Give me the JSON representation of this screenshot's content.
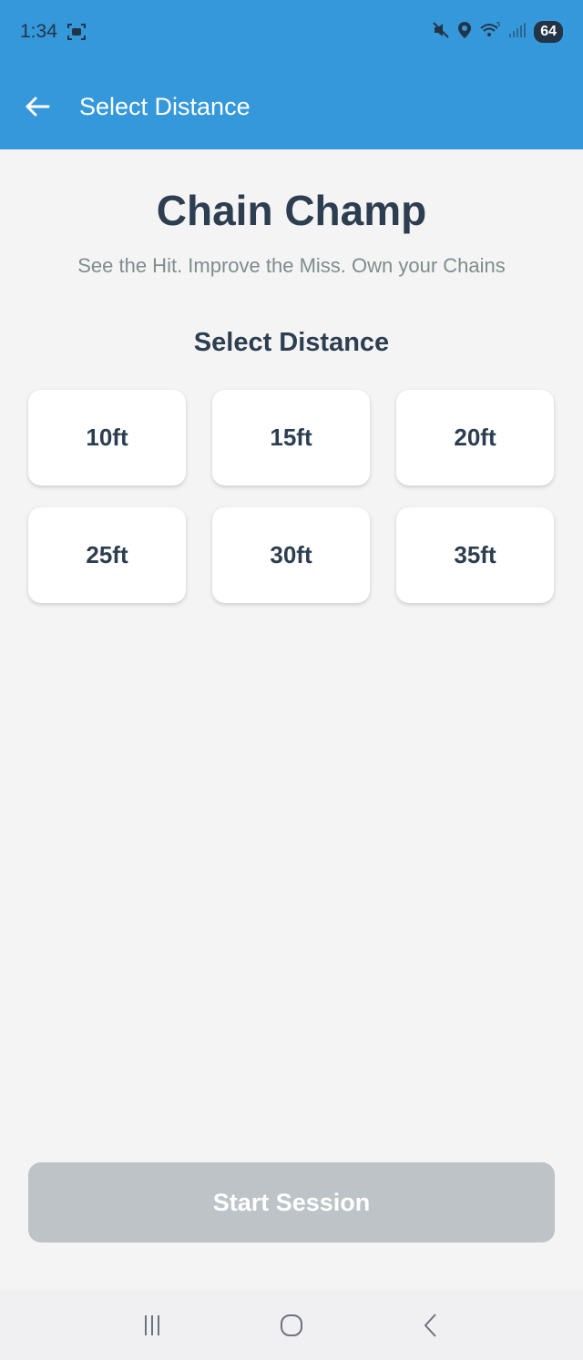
{
  "status_bar": {
    "time": "1:34",
    "battery": "64",
    "icons": [
      "screen-record-icon",
      "mute-icon",
      "location-icon",
      "wifi-icon",
      "signal-icon"
    ]
  },
  "app_bar": {
    "title": "Select Distance",
    "back_icon": "arrow-left-icon"
  },
  "main": {
    "brand_title": "Chain Champ",
    "tagline": "See the Hit. Improve the Miss. Own your Chains",
    "section_title": "Select Distance",
    "distances": [
      "10ft",
      "15ft",
      "20ft",
      "25ft",
      "30ft",
      "35ft"
    ],
    "start_button": "Start Session"
  },
  "nav_bar": {
    "icons": [
      "recent-apps-icon",
      "home-icon",
      "back-icon"
    ]
  },
  "colors": {
    "primary": "#3498db",
    "text_dark": "#2c3e50",
    "text_muted": "#7f8c8d",
    "disabled_button": "#bdc3c7",
    "background": "#f4f4f5"
  }
}
